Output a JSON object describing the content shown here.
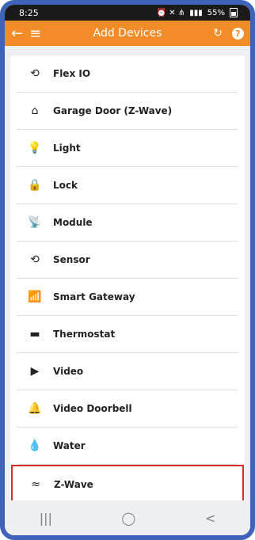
{
  "status_bar": {
    "time": "8:25",
    "icons": "alarm-icon mute-icon wifi-icon signal-icon",
    "battery": "55%"
  },
  "header": {
    "back_icon": "←",
    "menu_icon": "≡",
    "title": "Add Devices",
    "refresh_icon": "↻",
    "help_icon": "?"
  },
  "devices": [
    {
      "label": "Flex IO",
      "icon": "⟲"
    },
    {
      "label": "Garage Door (Z-Wave)",
      "icon": "⌂"
    },
    {
      "label": "Light",
      "icon": "💡"
    },
    {
      "label": "Lock",
      "icon": "🔒"
    },
    {
      "label": "Module",
      "icon": "📡"
    },
    {
      "label": "Sensor",
      "icon": "⟲"
    },
    {
      "label": "Smart Gateway",
      "icon": "📶"
    },
    {
      "label": "Thermostat",
      "icon": "▬"
    },
    {
      "label": "Video",
      "icon": "▶"
    },
    {
      "label": "Video Doorbell",
      "icon": "🔔"
    },
    {
      "label": "Water",
      "icon": "💧"
    },
    {
      "label": "Z-Wave",
      "icon": "≈"
    }
  ],
  "selected_device": "Z-Wave",
  "nav": {
    "recent": "|||",
    "home": "◯",
    "back": "<"
  }
}
